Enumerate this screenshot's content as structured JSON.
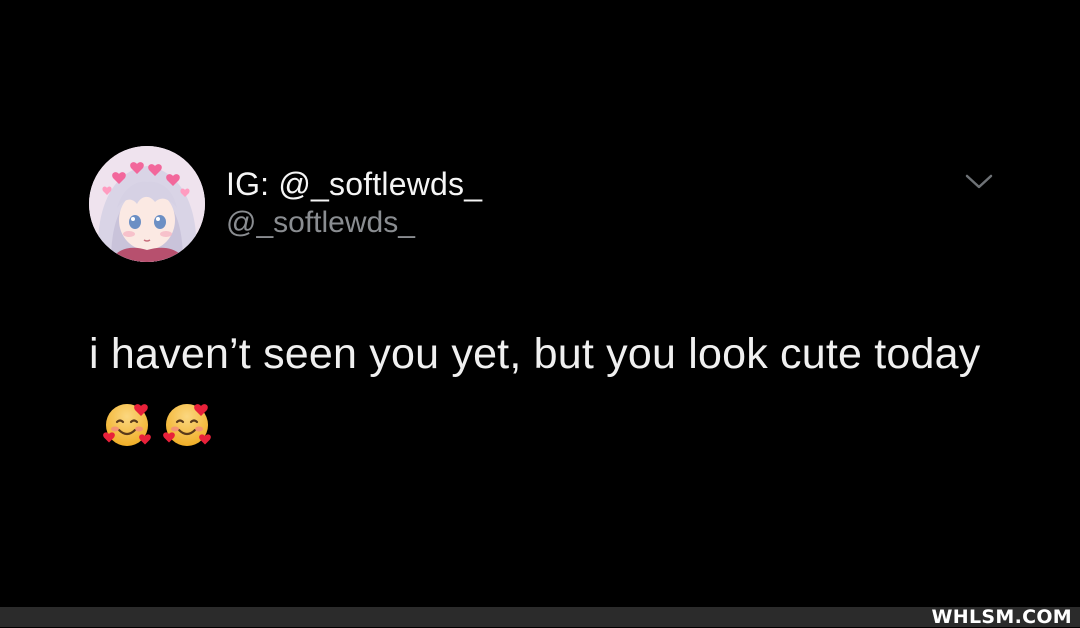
{
  "tweet": {
    "display_name": "IG: @_softlewds_",
    "handle": "@_softlewds_",
    "text": "i haven’t seen you yet, but you look cute today",
    "emojis": [
      "smiling-face-with-hearts",
      "smiling-face-with-hearts"
    ]
  },
  "watermark": "WHLSM.COM",
  "colors": {
    "background": "#000000",
    "text": "#f0f0f0",
    "secondary_text": "#8a8d91",
    "footer_bar": "#2b2b2b"
  },
  "icons": {
    "menu": "chevron-down-icon",
    "avatar": "anime-girl-avatar"
  }
}
